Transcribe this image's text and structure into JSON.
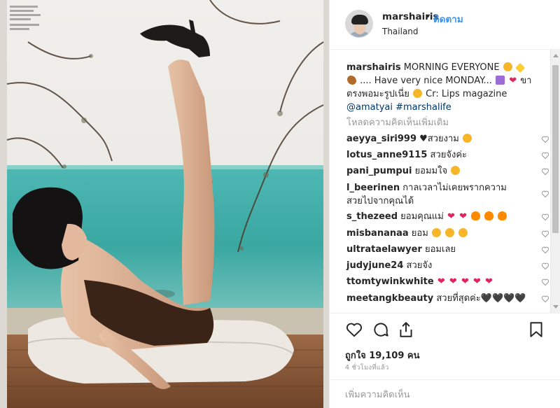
{
  "post": {
    "username": "marshairis",
    "dot": "•",
    "follow_label": "ติดตาม",
    "location": "Thailand"
  },
  "caption": {
    "username": "marshairis",
    "text_1": "MORNING EVERYONE",
    "text_2": ".... Have very nice MONDAY...",
    "text_3": "ขา ตรงพอมะรูปเนี่ย",
    "text_4": "Cr: Lips magazine",
    "mention": "@amatyai",
    "hashtag": "#marshalife"
  },
  "load_more_label": "โหลดความคิดเห็นเพิ่มเติม",
  "comments": [
    {
      "user": "aeyya_siri999",
      "text": "♥สวยงาม"
    },
    {
      "user": "lotus_anne9115",
      "text": "สวยจังค่ะ"
    },
    {
      "user": "pani_pumpui",
      "text": "ยอมมใจ"
    },
    {
      "user": "l_beerinen",
      "text": "กาลเวลาไม่เคยพรากความสวยไปจากคุณได้"
    },
    {
      "user": "s_thezeed",
      "text": "ยอมคุณแม่"
    },
    {
      "user": "misbananaa",
      "text": "ยอม"
    },
    {
      "user": "ultrataelawyer",
      "text": "ยอมเลย"
    },
    {
      "user": "judyjune24",
      "text": "สวยจัง"
    },
    {
      "user": "ttomtywinkwhite",
      "text": ""
    },
    {
      "user": "meetangkbeauty",
      "text": "สวยที่สุดค่ะ🖤🖤🖤🖤"
    }
  ],
  "likes_label": "ถูกใจ 19,109 คน",
  "time_label": "4 ชั่วโมงที่แล้ว",
  "add_comment_placeholder": "เพิ่มความคิดเห็น",
  "colors": {
    "accent": "#3897f0",
    "link": "#003569",
    "muted": "#999999",
    "heart": "#e0245e"
  }
}
